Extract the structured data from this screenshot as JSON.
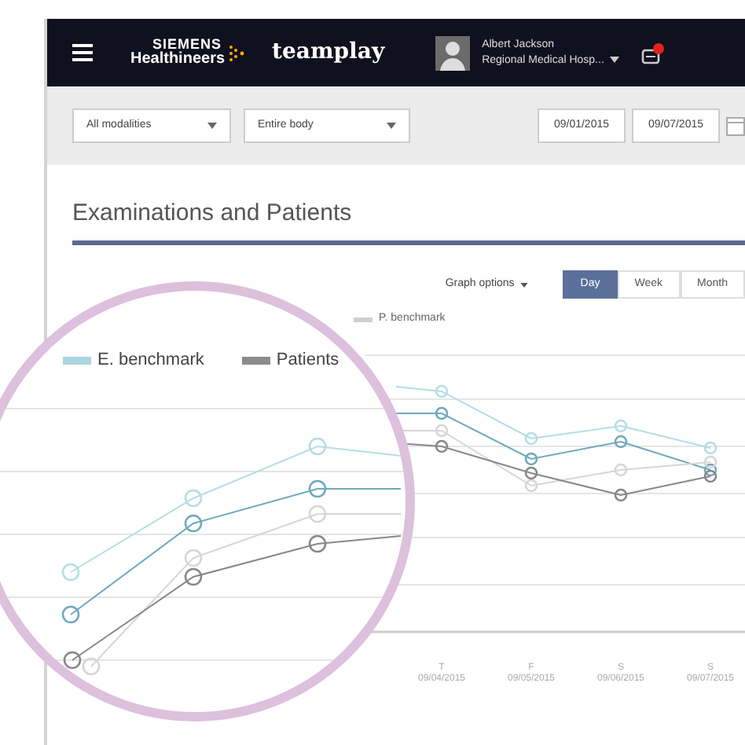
{
  "navbar": {
    "brand_top": "SIEMENS",
    "brand_bottom": "Healthineers",
    "product": "teamplay",
    "user_name": "Albert Jackson",
    "user_org": "Regional Medical Hosp..."
  },
  "filters": [
    {
      "value": "All modalities"
    },
    {
      "value": "Entire body"
    }
  ],
  "dates": [
    "09/01/2015",
    "09/07/2015"
  ],
  "section_title": "Examinations and Patients",
  "graph_options": "Graph options",
  "period_tabs": [
    {
      "label": "Day",
      "selected": true
    },
    {
      "label": "Week",
      "selected": false
    },
    {
      "label": "Month",
      "selected": false
    }
  ],
  "legend": [
    {
      "label": "P. benchmark",
      "color": "#cfcfcf"
    }
  ],
  "x_axis": [
    {
      "day": "T",
      "date": "09/04/2015"
    },
    {
      "day": "F",
      "date": "09/05/2015"
    },
    {
      "day": "S",
      "date": "09/06/2015"
    },
    {
      "day": "S",
      "date": "09/07/2015"
    }
  ],
  "magnifier": {
    "legend": [
      {
        "label": "E. benchmark",
        "color": "#a9d6df"
      },
      {
        "label": "Patients",
        "color": "#8c8c8c"
      }
    ]
  }
}
